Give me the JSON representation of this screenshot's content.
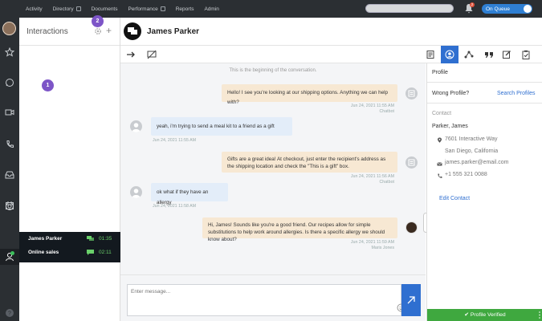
{
  "topnav": {
    "items": [
      "Activity",
      "Directory",
      "Documents",
      "Performance",
      "Reports",
      "Admin"
    ],
    "notification_count": "2",
    "queue_label": "On Queue"
  },
  "interactions": {
    "title": "Interactions",
    "badges": [
      "1",
      "2"
    ],
    "list": [
      {
        "name": "James Parker",
        "time": "01:35",
        "channel_icon": "chat-icon"
      },
      {
        "name": "Online sales",
        "time": "02:11",
        "channel_icon": "chat-icon"
      }
    ]
  },
  "conversation": {
    "name": "James Parker",
    "start_text": "This is the beginning of the conversation.",
    "messages": [
      {
        "side": "out",
        "text": "Hello! I see you're looking at our shipping options. Anything we can help with?",
        "time": "Jun 24, 2021 11:55 AM",
        "author": "Chatbot"
      },
      {
        "side": "in",
        "text": "yeah, i'm trying to send a meal kit to a friend as a gift",
        "time": "Jun 24, 2021 11:55 AM",
        "author": ""
      },
      {
        "side": "out",
        "text": "Gifts are a great idea! At checkout, just enter the recipient's address as the shipping location and check the \"This is a gift\" box.",
        "time": "Jun 24, 2021 11:56 AM",
        "author": "Chatbot"
      },
      {
        "side": "in",
        "text": "ok what if they have an allergy",
        "time": "Jun 24, 2021 11:58 AM",
        "author": ""
      },
      {
        "side": "out",
        "text": "Hi, James! Sounds like you're a good friend. Our recipes allow for simple substitutions to help work around allergies. Is there a specific allergy we should know about?",
        "time": "Jun 24, 2021 11:59 AM",
        "author": "Maris Jones"
      }
    ],
    "composer_placeholder": "Enter message..."
  },
  "profile": {
    "title": "Profile",
    "wrong_profile": "Wrong Profile?",
    "search_profiles": "Search Profiles",
    "contact_label": "Contact",
    "name": "Parker, James",
    "address_line1": "7601 Interactive Way",
    "address_line2": "San Diego, California",
    "email": "james.parker@email.com",
    "phone": "+1 555 321 0088",
    "edit_contact": "Edit Contact",
    "verified": "Profile Verified"
  },
  "colors": {
    "accent": "#2f6fd0",
    "badge": "#7d55c7",
    "verified": "#3fa83f",
    "bot_bubble": "#f7e8d3",
    "customer_bubble": "#e3edf9"
  }
}
